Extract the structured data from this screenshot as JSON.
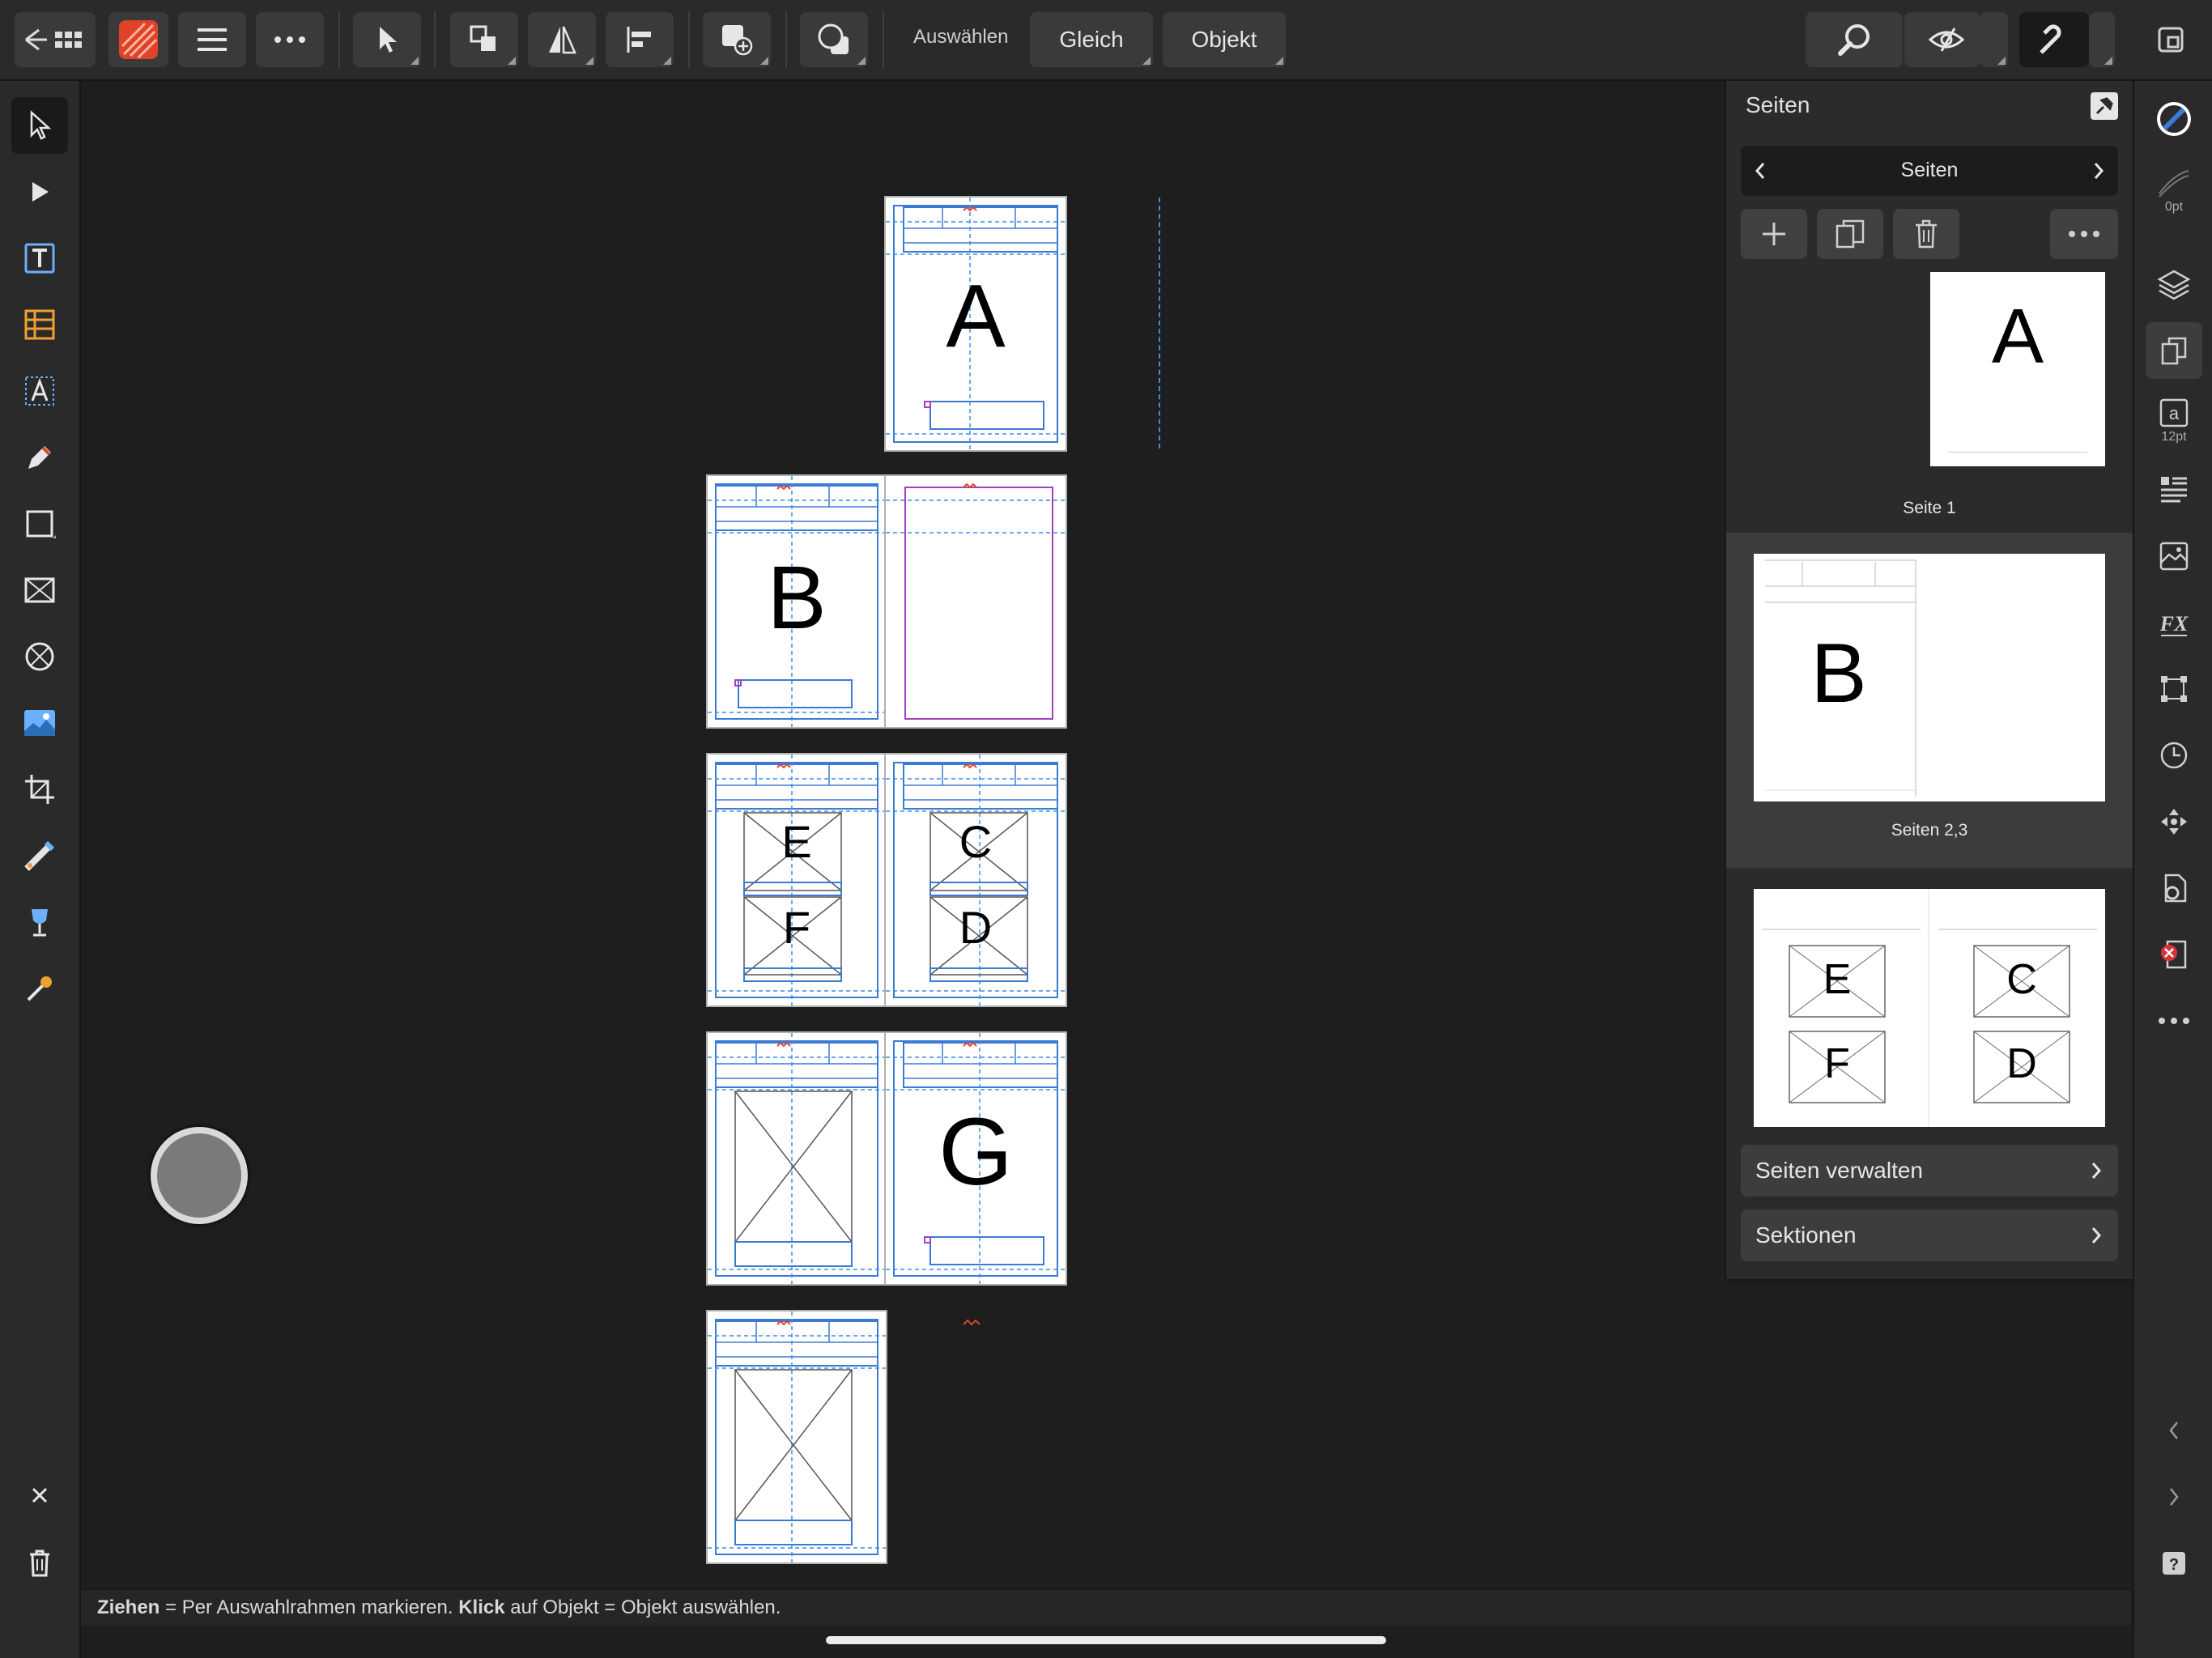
{
  "toolbar": {
    "select_label": "Auswählen",
    "same_label": "Gleich",
    "object_label": "Objekt"
  },
  "panel": {
    "title": "Seiten",
    "nav_label": "Seiten",
    "page1_letter": "A",
    "page1_label": "Seite 1",
    "page23_letter": "B",
    "page23_label": "Seiten 2,3",
    "thumb3_letters": [
      "E",
      "F",
      "C",
      "D"
    ],
    "manage_label": "Seiten verwalten",
    "sections_label": "Sektionen"
  },
  "right_strip": {
    "stroke_label": "0pt",
    "text_size_label": "12pt"
  },
  "canvas": {
    "page_letters": [
      "A",
      "B",
      "E",
      "F",
      "C",
      "D",
      "G"
    ]
  },
  "status": {
    "drag_word": "Ziehen",
    "drag_text": " = Per Auswahlrahmen markieren. ",
    "click_word": "Klick",
    "click_text": " auf Objekt = Objekt auswählen."
  },
  "colors": {
    "accent_blue": "#3b7bd6",
    "guide_blue": "#3a8ee6",
    "frame_purple": "#a040c0",
    "app_icon": "#e0432a"
  }
}
